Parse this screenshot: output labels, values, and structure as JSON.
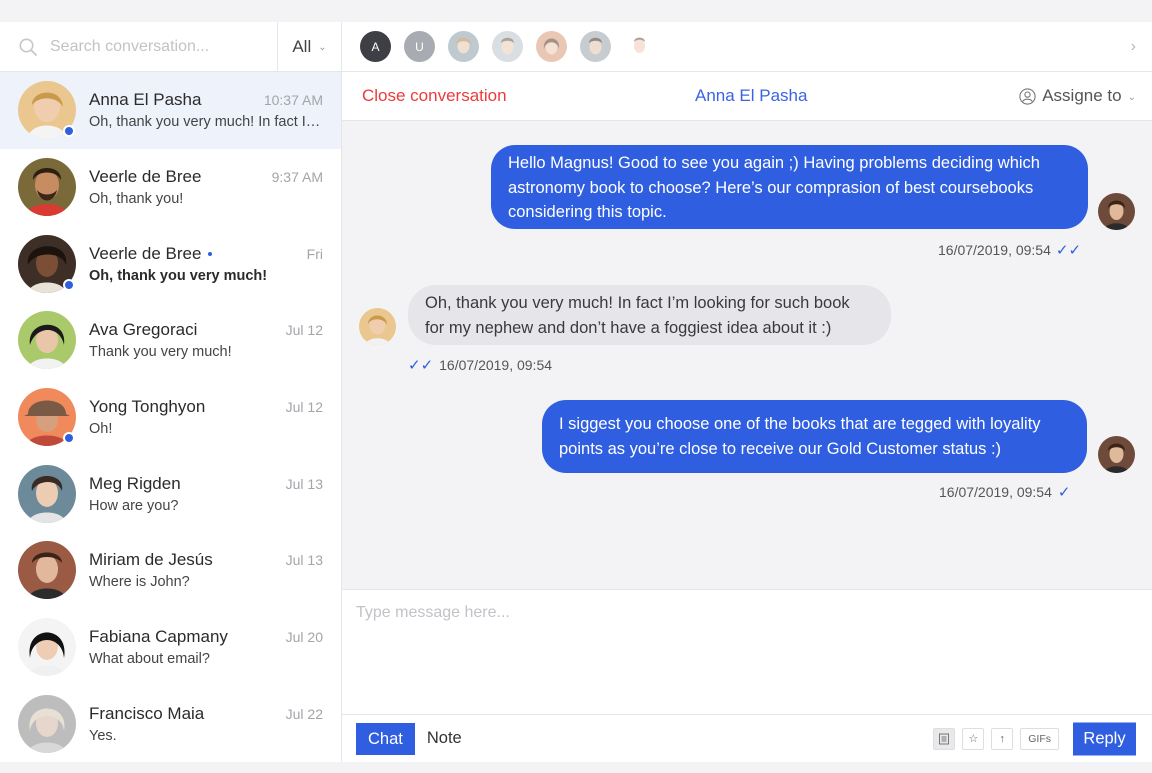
{
  "search": {
    "placeholder": "Search conversation...",
    "filter_label": "All"
  },
  "colors": {
    "accent": "#2f5fe0",
    "danger": "#ec3b3b",
    "online": "#2f5fe0"
  },
  "conversations": [
    {
      "name": "Anna El Pasha",
      "time": "10:37 AM",
      "preview": "Oh, thank you very much! In fact I’m looking for such book",
      "online": true,
      "unread": false,
      "active": true
    },
    {
      "name": "Veerle de Bree",
      "time": "9:37 AM",
      "preview": "Oh, thank you!",
      "online": false,
      "unread": false
    },
    {
      "name": "Veerle de Bree",
      "time": "Fri",
      "preview": "Oh, thank you very much!",
      "online": true,
      "unread": true
    },
    {
      "name": "Ava Gregoraci",
      "time": "Jul 12",
      "preview": "Thank you very much!",
      "online": false,
      "unread": false
    },
    {
      "name": "Yong Tonghyon",
      "time": "Jul 12",
      "preview": "Oh!",
      "online": true,
      "unread": false
    },
    {
      "name": "Meg Rigden",
      "time": "Jul 13",
      "preview": "How are you?",
      "online": false,
      "unread": false
    },
    {
      "name": "Miriam de Jesús",
      "time": "Jul 13",
      "preview": "Where is John?",
      "online": false,
      "unread": false
    },
    {
      "name": "Fabiana Capmany",
      "time": "Jul 20",
      "preview": "What about email?",
      "online": false,
      "unread": false
    },
    {
      "name": "Francisco Maia",
      "time": "Jul 22",
      "preview": "Yes.",
      "online": false,
      "unread": false
    }
  ],
  "agents": [
    {
      "letter": "A"
    },
    {
      "letter": "U"
    },
    {
      "letter": ""
    },
    {
      "letter": ""
    },
    {
      "letter": ""
    },
    {
      "letter": ""
    },
    {
      "letter": ""
    }
  ],
  "header": {
    "close_label": "Close conversation",
    "contact_name": "Anna El Pasha",
    "assign_label": "Assigne to"
  },
  "messages": [
    {
      "direction": "out",
      "lines": [
        "Hello Magnus! Good to see you again ;) Having problems deciding which",
        "astronomy  book to choose? Here’s our comprasion of best coursebooks",
        "considering this topic."
      ],
      "time": "16/07/2019, 09:54",
      "check": "✓✓"
    },
    {
      "direction": "in",
      "lines": [
        "Oh, thank you very much! In fact I’m looking for such book",
        "for my nephew and don’t have a foggiest idea about it :)"
      ],
      "time": "16/07/2019, 09:54",
      "check": "✓✓"
    },
    {
      "direction": "out",
      "lines": [
        "I siggest you choose one of the books that are tegged with loyality",
        "points as you’re close to receive our Gold Customer status :)"
      ],
      "time": "16/07/2019, 09:54",
      "check": "✓"
    }
  ],
  "composer": {
    "placeholder": "Type message here...",
    "tab_chat": "Chat",
    "tab_note": "Note",
    "gif_label": "GIFs",
    "reply_label": "Reply"
  },
  "icons": {
    "search": "search-icon",
    "filter_chevron": "chevron-down-icon",
    "bar_chevron": "chevron-right-icon",
    "assign": "person-circle-icon",
    "template": "document-icon",
    "star": "star-icon",
    "upload": "arrow-up-icon"
  }
}
